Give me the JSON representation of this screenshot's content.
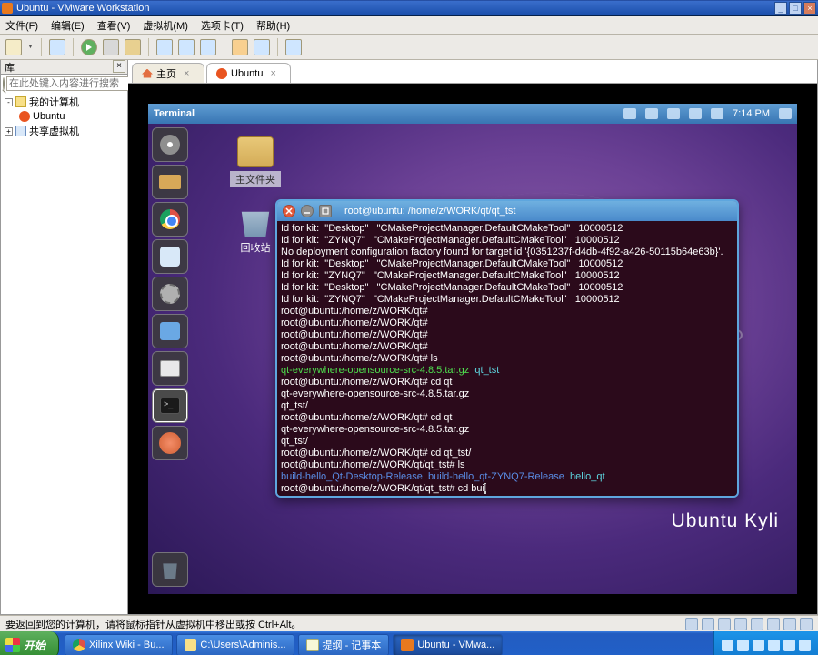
{
  "xp_titlebar": {
    "title": "Ubuntu - VMware Workstation"
  },
  "menubar": {
    "file": "文件(F)",
    "edit": "编辑(E)",
    "view": "查看(V)",
    "vm": "虚拟机(M)",
    "tabs": "选项卡(T)",
    "help": "帮助(H)"
  },
  "library": {
    "header": "库",
    "search_placeholder": "在此处键入内容进行搜索",
    "root": "我的计算机",
    "items": [
      "Ubuntu",
      "共享虚拟机"
    ]
  },
  "tabs": {
    "home": "主页",
    "guest": "Ubuntu"
  },
  "ubuntu_topbar": {
    "title": "Terminal",
    "time": "7:14 PM"
  },
  "desk": {
    "folder": "主文件夹",
    "trash": "回收站"
  },
  "kylin": "Ubuntu Kyli",
  "terminal": {
    "title": "root@ubuntu: /home/z/WORK/qt/qt_tst",
    "lines": [
      {
        "s": "w",
        "t": "Id for kit:  \"Desktop\"   \"CMakeProjectManager.DefaultCMakeTool\"   10000512"
      },
      {
        "s": "w",
        "t": "Id for kit:  \"ZYNQ7\"   \"CMakeProjectManager.DefaultCMakeTool\"   10000512"
      },
      {
        "s": "w",
        "t": "No deployment configuration factory found for target id '{0351237f-d4db-4f92-a426-50115b64e63b}'."
      },
      {
        "s": "w",
        "t": "Id for kit:  \"Desktop\"   \"CMakeProjectManager.DefaultCMakeTool\"   10000512"
      },
      {
        "s": "w",
        "t": "Id for kit:  \"ZYNQ7\"   \"CMakeProjectManager.DefaultCMakeTool\"   10000512"
      },
      {
        "s": "w",
        "t": "Id for kit:  \"Desktop\"   \"CMakeProjectManager.DefaultCMakeTool\"   10000512"
      },
      {
        "s": "w",
        "t": "Id for kit:  \"ZYNQ7\"   \"CMakeProjectManager.DefaultCMakeTool\"   10000512"
      },
      {
        "s": "w",
        "t": "root@ubuntu:/home/z/WORK/qt#"
      },
      {
        "s": "w",
        "t": "root@ubuntu:/home/z/WORK/qt#"
      },
      {
        "s": "w",
        "t": "root@ubuntu:/home/z/WORK/qt#"
      },
      {
        "s": "w",
        "t": "root@ubuntu:/home/z/WORK/qt#"
      },
      {
        "s": "w",
        "t": "root@ubuntu:/home/z/WORK/qt# ls"
      },
      {
        "s": "mix",
        "p": [
          {
            "c": "g",
            "t": "qt-everywhere-opensource-src-4.8.5.tar.gz"
          },
          {
            "c": "w",
            "t": "  "
          },
          {
            "c": "c",
            "t": "qt_tst"
          }
        ]
      },
      {
        "s": "w",
        "t": "root@ubuntu:/home/z/WORK/qt# cd qt"
      },
      {
        "s": "w",
        "t": "qt-everywhere-opensource-src-4.8.5.tar.gz"
      },
      {
        "s": "w",
        "t": "qt_tst/"
      },
      {
        "s": "w",
        "t": "root@ubuntu:/home/z/WORK/qt# cd qt"
      },
      {
        "s": "w",
        "t": "qt-everywhere-opensource-src-4.8.5.tar.gz"
      },
      {
        "s": "w",
        "t": "qt_tst/"
      },
      {
        "s": "w",
        "t": "root@ubuntu:/home/z/WORK/qt# cd qt_tst/"
      },
      {
        "s": "w",
        "t": "root@ubuntu:/home/z/WORK/qt/qt_tst# ls"
      },
      {
        "s": "mix",
        "p": [
          {
            "c": "b",
            "t": "build-hello_Qt-Desktop-Release"
          },
          {
            "c": "w",
            "t": "  "
          },
          {
            "c": "b",
            "t": "build-hello_qt-ZYNQ7-Release"
          },
          {
            "c": "w",
            "t": "  "
          },
          {
            "c": "c",
            "t": "hello_qt"
          }
        ]
      },
      {
        "s": "mix",
        "p": [
          {
            "c": "w",
            "t": "root@ubuntu:/home/z/WORK/qt/qt_tst# cd bui"
          },
          {
            "c": "cur",
            "t": "l"
          }
        ]
      }
    ]
  },
  "status": {
    "text": "要返回到您的计算机，请将鼠标指针从虚拟机中移出或按 Ctrl+Alt。"
  },
  "taskbar": {
    "start": "开始",
    "items": [
      {
        "label": "Xilinx Wiki - Bu...",
        "icon": "chr"
      },
      {
        "label": "C:\\Users\\Adminis...",
        "icon": "folder"
      },
      {
        "label": "提纲 - 记事本",
        "icon": "np"
      },
      {
        "label": "Ubuntu - VMwa...",
        "icon": "vm",
        "active": true
      }
    ]
  }
}
